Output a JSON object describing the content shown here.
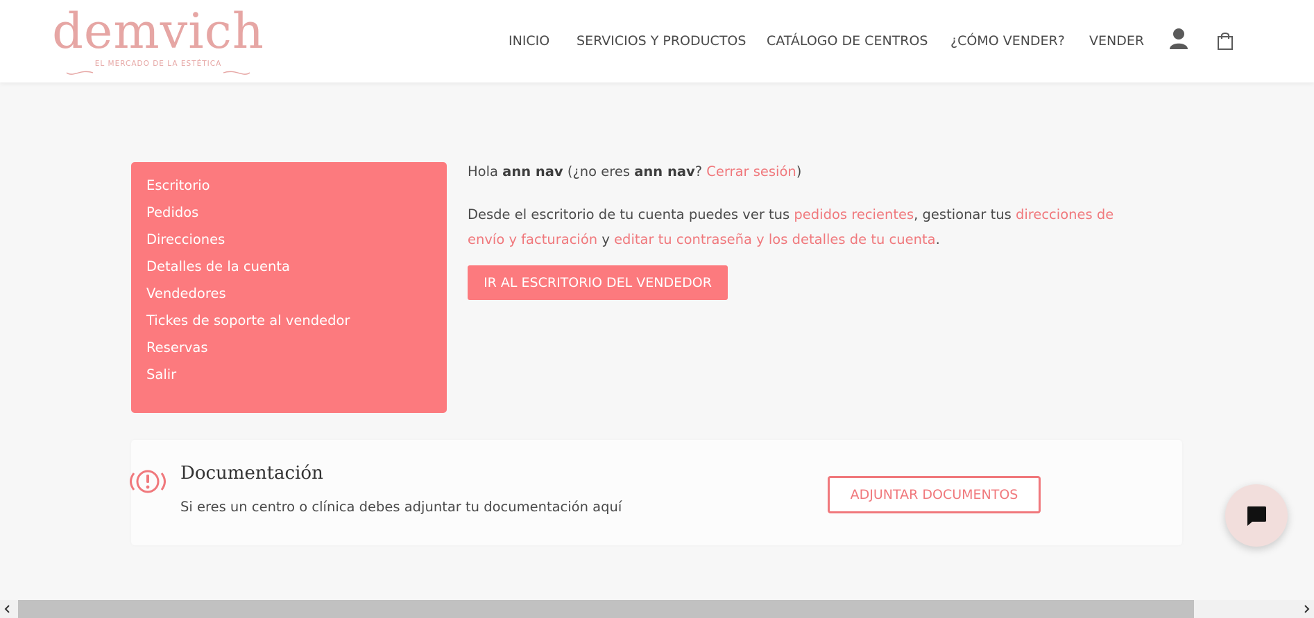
{
  "brand": {
    "name": "demvich",
    "tagline": "EL MERCADO DE LA ESTÉTICA",
    "accent_color": "#fc7a7e",
    "logo_color": "#e6a6a4"
  },
  "nav": {
    "items": [
      {
        "label": "INICIO"
      },
      {
        "label": "SERVICIOS Y PRODUCTOS"
      },
      {
        "label": "CATÁLOGO DE CENTROS"
      },
      {
        "label": "¿CÓMO VENDER?"
      },
      {
        "label": "VENDER"
      }
    ],
    "icons": [
      "user-icon",
      "shopping-bag-icon"
    ]
  },
  "sidebar": {
    "items": [
      {
        "label": "Escritorio"
      },
      {
        "label": "Pedidos"
      },
      {
        "label": "Direcciones"
      },
      {
        "label": "Detalles de la cuenta"
      },
      {
        "label": "Vendedores"
      },
      {
        "label": "Tickes de soporte al vendedor"
      },
      {
        "label": "Reservas"
      },
      {
        "label": "Salir"
      }
    ]
  },
  "dashboard": {
    "greeting_prefix": "Hola ",
    "user_name": "ann nav",
    "greeting_mid": " (¿no eres ",
    "greeting_q": "?",
    "logout_link": "Cerrar sesión",
    "greeting_end": ")",
    "desc_1": "Desde el escritorio de tu cuenta puedes ver tus ",
    "link_orders": "pedidos recientes",
    "desc_2": ", gestionar tus ",
    "link_addresses": "direcciones de envío y facturación",
    "desc_3": " y ",
    "link_account": "editar tu contraseña y los detalles de tu cuenta",
    "desc_4": ".",
    "vendor_button": "IR AL ESCRITORIO DEL VENDEDOR"
  },
  "documentation": {
    "title": "Documentación",
    "text": "Si eres un centro o clínica debes adjuntar tu documentación aquí",
    "button": "ADJUNTAR DOCUMENTOS",
    "icon": "alert-icon"
  },
  "chat": {
    "icon": "chat-icon"
  },
  "scrollbar": {
    "thumb_fraction": 0.92
  }
}
